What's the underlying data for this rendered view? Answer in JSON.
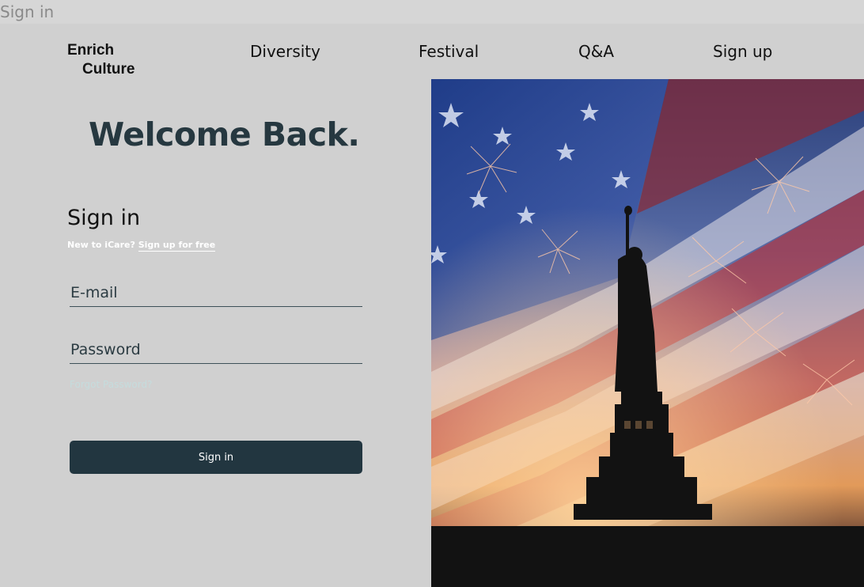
{
  "window": {
    "title": "Sign in"
  },
  "header": {
    "logo_line1": "Enrich",
    "logo_line2": "Culture",
    "nav": [
      "Diversity",
      "Festival",
      "Q&A",
      "Sign up"
    ]
  },
  "main": {
    "welcome": "Welcome Back.",
    "signin_title": "Sign in",
    "signup_prompt": "New to iCare?",
    "signup_link": "Sign up for free",
    "email_placeholder": "E-mail",
    "password_placeholder": "Password",
    "forgot_password": "Forgot Password?",
    "signin_button": "Sign in"
  },
  "colors": {
    "background": "#d0d0d0",
    "primary": "#223640",
    "heading": "#263840"
  },
  "hero_image": {
    "subject": "statue-of-liberty-flag-fireworks"
  }
}
